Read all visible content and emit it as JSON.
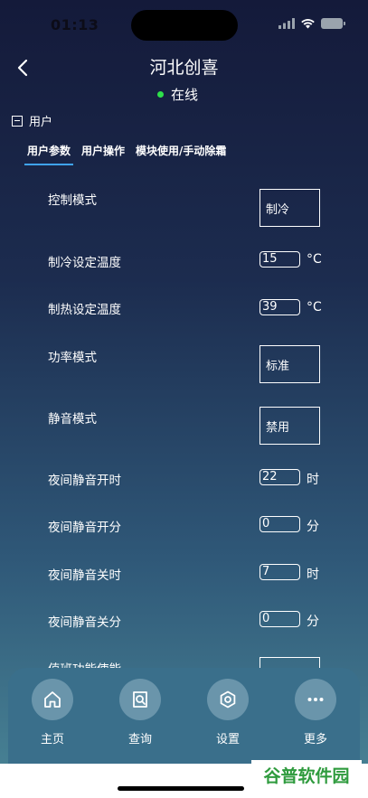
{
  "status_bar": {
    "time": "01:13"
  },
  "header": {
    "title": "河北创喜",
    "status": "在线"
  },
  "section": {
    "label": "用户"
  },
  "tabs": [
    {
      "label": "用户参数",
      "active": true
    },
    {
      "label": "用户操作",
      "active": false
    },
    {
      "label": "模块使用/手动除霜",
      "active": false
    }
  ],
  "params": {
    "control_mode": {
      "label": "控制模式",
      "value": "制冷"
    },
    "cool_temp": {
      "label": "制冷设定温度",
      "value": "15",
      "unit": "°C"
    },
    "heat_temp": {
      "label": "制热设定温度",
      "value": "39",
      "unit": "°C"
    },
    "power_mode": {
      "label": "功率模式",
      "value": "标准"
    },
    "mute_mode": {
      "label": "静音模式",
      "value": "禁用"
    },
    "night_mute_on_hour": {
      "label": "夜间静音开时",
      "value": "22",
      "unit": "时"
    },
    "night_mute_on_min": {
      "label": "夜间静音开分",
      "value": "0",
      "unit": "分"
    },
    "night_mute_off_hour": {
      "label": "夜间静音关时",
      "value": "7",
      "unit": "时"
    },
    "night_mute_off_min": {
      "label": "夜间静音关分",
      "value": "0",
      "unit": "分"
    },
    "partial_row": {
      "label": "值班功能使能"
    }
  },
  "bottom_nav": {
    "home": "主页",
    "query": "查询",
    "settings": "设置",
    "more": "更多"
  },
  "watermark": "谷普软件园",
  "colors": {
    "accent": "#3fa3f0",
    "online": "#2ee04a",
    "nav_bg": "#3a6f8b"
  }
}
